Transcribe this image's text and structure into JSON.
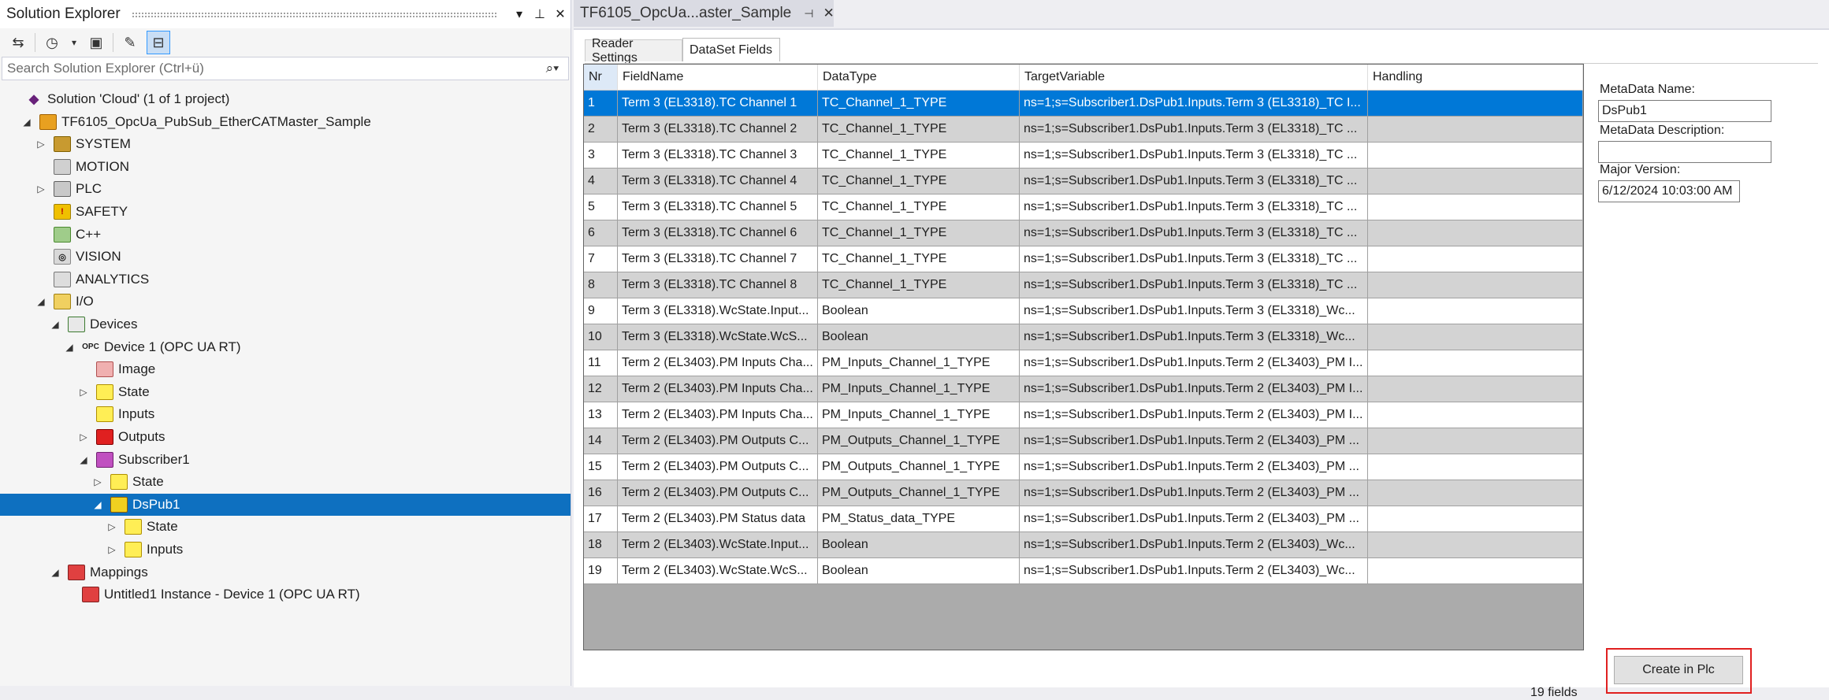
{
  "solution_explorer": {
    "title": "Solution Explorer",
    "search_placeholder": "Search Solution Explorer (Ctrl+ü)",
    "tree": [
      {
        "label": "Solution 'Cloud' (1 of 1 project)",
        "indent": 0,
        "arrow": "",
        "icon": "solution-icon",
        "cls": "ico-sol",
        "glyph": "◆"
      },
      {
        "label": "TF6105_OpcUa_PubSub_EtherCATMaster_Sample",
        "indent": 1,
        "arrow": "◢",
        "icon": "project-icon",
        "cls": "ico-proj",
        "glyph": ""
      },
      {
        "label": "SYSTEM",
        "indent": 2,
        "arrow": "▷",
        "icon": "system-icon",
        "cls": "ico-sys",
        "glyph": ""
      },
      {
        "label": "MOTION",
        "indent": 2,
        "arrow": "",
        "icon": "motion-icon",
        "cls": "ico-mot",
        "glyph": ""
      },
      {
        "label": "PLC",
        "indent": 2,
        "arrow": "▷",
        "icon": "plc-icon",
        "cls": "ico-plc",
        "glyph": ""
      },
      {
        "label": "SAFETY",
        "indent": 2,
        "arrow": "",
        "icon": "safety-icon",
        "cls": "ico-safe",
        "glyph": "!"
      },
      {
        "label": "C++",
        "indent": 2,
        "arrow": "",
        "icon": "cpp-icon",
        "cls": "ico-cpp",
        "glyph": ""
      },
      {
        "label": "VISION",
        "indent": 2,
        "arrow": "",
        "icon": "vision-icon",
        "cls": "ico-vis",
        "glyph": "◎"
      },
      {
        "label": "ANALYTICS",
        "indent": 2,
        "arrow": "",
        "icon": "analytics-icon",
        "cls": "ico-ana",
        "glyph": ""
      },
      {
        "label": "I/O",
        "indent": 2,
        "arrow": "◢",
        "icon": "io-icon",
        "cls": "ico-io",
        "glyph": ""
      },
      {
        "label": "Devices",
        "indent": 3,
        "arrow": "◢",
        "icon": "devices-icon",
        "cls": "ico-dev",
        "glyph": ""
      },
      {
        "label": "Device 1 (OPC UA RT)",
        "indent": 4,
        "arrow": "◢",
        "icon": "opc-device-icon",
        "cls": "ico-opc",
        "glyph": "OPC"
      },
      {
        "label": "Image",
        "indent": 5,
        "arrow": "",
        "icon": "image-icon",
        "cls": "ico-img",
        "glyph": ""
      },
      {
        "label": "State",
        "indent": 5,
        "arrow": "▷",
        "icon": "state-icon",
        "cls": "ico-yel",
        "glyph": ""
      },
      {
        "label": "Inputs",
        "indent": 5,
        "arrow": "",
        "icon": "inputs-icon",
        "cls": "ico-yel",
        "glyph": ""
      },
      {
        "label": "Outputs",
        "indent": 5,
        "arrow": "▷",
        "icon": "outputs-icon",
        "cls": "ico-red",
        "glyph": ""
      },
      {
        "label": "Subscriber1",
        "indent": 5,
        "arrow": "◢",
        "icon": "subscriber-icon",
        "cls": "ico-sub",
        "glyph": ""
      },
      {
        "label": "State",
        "indent": 6,
        "arrow": "▷",
        "icon": "state-icon",
        "cls": "ico-yel",
        "glyph": ""
      },
      {
        "label": "DsPub1",
        "indent": 6,
        "arrow": "◢",
        "icon": "dataset-icon",
        "cls": "ico-ds",
        "glyph": "",
        "selected": true
      },
      {
        "label": "State",
        "indent": 7,
        "arrow": "▷",
        "icon": "state-icon",
        "cls": "ico-yel",
        "glyph": ""
      },
      {
        "label": "Inputs",
        "indent": 7,
        "arrow": "▷",
        "icon": "inputs-icon",
        "cls": "ico-yel",
        "glyph": ""
      },
      {
        "label": "Mappings",
        "indent": 3,
        "arrow": "◢",
        "icon": "mappings-icon",
        "cls": "ico-map",
        "glyph": ""
      },
      {
        "label": "Untitled1 Instance - Device 1 (OPC UA RT)",
        "indent": 4,
        "arrow": "",
        "icon": "mapping-instance-icon",
        "cls": "ico-map",
        "glyph": ""
      }
    ]
  },
  "document_tab": {
    "title": "TF6105_OpcUa...aster_Sample"
  },
  "sub_tabs": {
    "reader_settings": "Reader Settings",
    "dataset_fields": "DataSet Fields"
  },
  "grid": {
    "columns": [
      "Nr",
      "FieldName",
      "DataType",
      "TargetVariable",
      "Handling"
    ],
    "rows": [
      [
        "1",
        "Term 3 (EL3318).TC Channel 1",
        "TC_Channel_1_TYPE",
        "ns=1;s=Subscriber1.DsPub1.Inputs.Term 3 (EL3318)_TC I...",
        ""
      ],
      [
        "2",
        "Term 3 (EL3318).TC Channel 2",
        "TC_Channel_1_TYPE",
        "ns=1;s=Subscriber1.DsPub1.Inputs.Term 3 (EL3318)_TC ...",
        ""
      ],
      [
        "3",
        "Term 3 (EL3318).TC Channel 3",
        "TC_Channel_1_TYPE",
        "ns=1;s=Subscriber1.DsPub1.Inputs.Term 3 (EL3318)_TC ...",
        ""
      ],
      [
        "4",
        "Term 3 (EL3318).TC Channel 4",
        "TC_Channel_1_TYPE",
        "ns=1;s=Subscriber1.DsPub1.Inputs.Term 3 (EL3318)_TC ...",
        ""
      ],
      [
        "5",
        "Term 3 (EL3318).TC Channel 5",
        "TC_Channel_1_TYPE",
        "ns=1;s=Subscriber1.DsPub1.Inputs.Term 3 (EL3318)_TC ...",
        ""
      ],
      [
        "6",
        "Term 3 (EL3318).TC Channel 6",
        "TC_Channel_1_TYPE",
        "ns=1;s=Subscriber1.DsPub1.Inputs.Term 3 (EL3318)_TC ...",
        ""
      ],
      [
        "7",
        "Term 3 (EL3318).TC Channel 7",
        "TC_Channel_1_TYPE",
        "ns=1;s=Subscriber1.DsPub1.Inputs.Term 3 (EL3318)_TC ...",
        ""
      ],
      [
        "8",
        "Term 3 (EL3318).TC Channel 8",
        "TC_Channel_1_TYPE",
        "ns=1;s=Subscriber1.DsPub1.Inputs.Term 3 (EL3318)_TC ...",
        ""
      ],
      [
        "9",
        "Term 3 (EL3318).WcState.Input...",
        "Boolean",
        "ns=1;s=Subscriber1.DsPub1.Inputs.Term 3 (EL3318)_Wc...",
        ""
      ],
      [
        "10",
        "Term 3 (EL3318).WcState.WcS...",
        "Boolean",
        "ns=1;s=Subscriber1.DsPub1.Inputs.Term 3 (EL3318)_Wc...",
        ""
      ],
      [
        "11",
        "Term 2 (EL3403).PM Inputs Cha...",
        "PM_Inputs_Channel_1_TYPE",
        "ns=1;s=Subscriber1.DsPub1.Inputs.Term 2 (EL3403)_PM I...",
        ""
      ],
      [
        "12",
        "Term 2 (EL3403).PM Inputs Cha...",
        "PM_Inputs_Channel_1_TYPE",
        "ns=1;s=Subscriber1.DsPub1.Inputs.Term 2 (EL3403)_PM I...",
        ""
      ],
      [
        "13",
        "Term 2 (EL3403).PM Inputs Cha...",
        "PM_Inputs_Channel_1_TYPE",
        "ns=1;s=Subscriber1.DsPub1.Inputs.Term 2 (EL3403)_PM I...",
        ""
      ],
      [
        "14",
        "Term 2 (EL3403).PM Outputs C...",
        "PM_Outputs_Channel_1_TYPE",
        "ns=1;s=Subscriber1.DsPub1.Inputs.Term 2 (EL3403)_PM ...",
        ""
      ],
      [
        "15",
        "Term 2 (EL3403).PM Outputs C...",
        "PM_Outputs_Channel_1_TYPE",
        "ns=1;s=Subscriber1.DsPub1.Inputs.Term 2 (EL3403)_PM ...",
        ""
      ],
      [
        "16",
        "Term 2 (EL3403).PM Outputs C...",
        "PM_Outputs_Channel_1_TYPE",
        "ns=1;s=Subscriber1.DsPub1.Inputs.Term 2 (EL3403)_PM ...",
        ""
      ],
      [
        "17",
        "Term 2 (EL3403).PM Status data",
        "PM_Status_data_TYPE",
        "ns=1;s=Subscriber1.DsPub1.Inputs.Term 2 (EL3403)_PM ...",
        ""
      ],
      [
        "18",
        "Term 2 (EL3403).WcState.Input...",
        "Boolean",
        "ns=1;s=Subscriber1.DsPub1.Inputs.Term 2 (EL3403)_Wc...",
        ""
      ],
      [
        "19",
        "Term 2 (EL3403).WcState.WcS...",
        "Boolean",
        "ns=1;s=Subscriber1.DsPub1.Inputs.Term 2 (EL3403)_Wc...",
        ""
      ]
    ],
    "selected_row": 0,
    "field_count": "19 fields"
  },
  "metadata": {
    "name_label": "MetaData Name:",
    "name_value": "DsPub1",
    "description_label": "MetaData Description:",
    "description_value": "",
    "version_label": "Major Version:",
    "version_value": "6/12/2024 10:03:00 AM"
  },
  "create_button": "Create in Plc",
  "colors": {
    "selection": "#0078d7",
    "tree_selection": "#0e70c0",
    "highlight_border": "#e02020"
  }
}
